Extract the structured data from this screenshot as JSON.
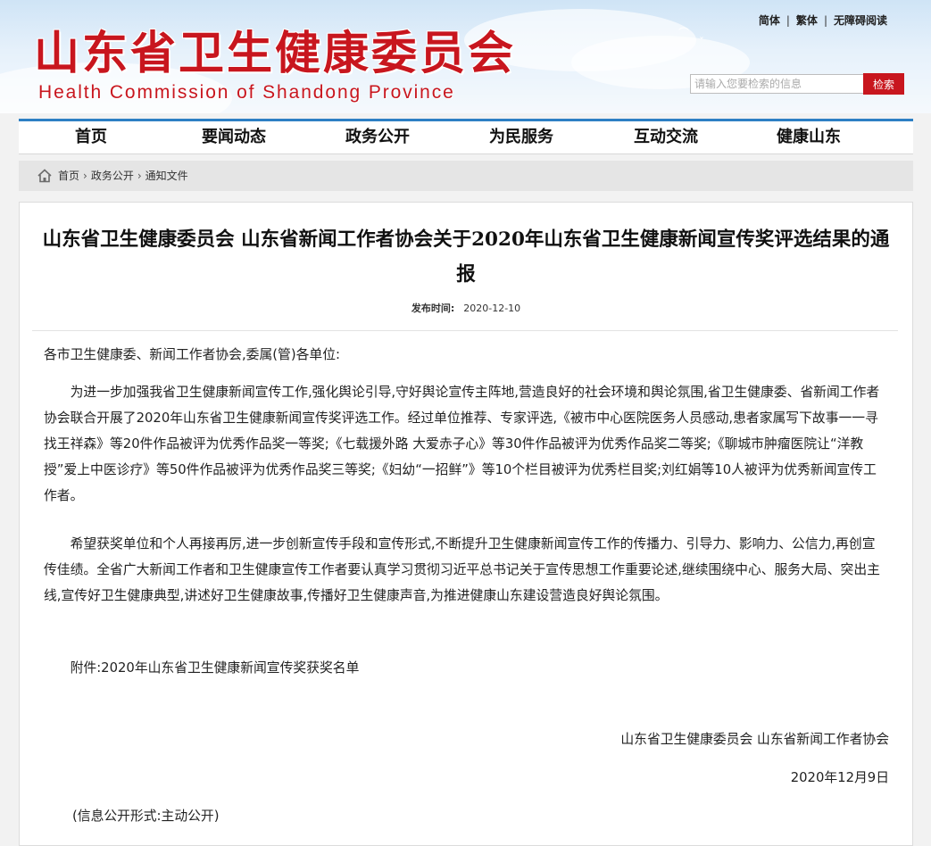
{
  "header": {
    "title": "山东省卫生健康委员会",
    "subtitle": "Health Commission of Shandong Province",
    "links": {
      "simplified": "简体",
      "traditional": "繁体",
      "accessible": "无障碍阅读"
    },
    "separator": "|",
    "search": {
      "placeholder": "请输入您要检索的信息",
      "button": "检索"
    }
  },
  "nav": {
    "items": [
      {
        "label": "首页"
      },
      {
        "label": "要闻动态"
      },
      {
        "label": "政务公开"
      },
      {
        "label": "为民服务"
      },
      {
        "label": "互动交流"
      },
      {
        "label": "健康山东"
      }
    ]
  },
  "breadcrumb": {
    "items": [
      "首页",
      "政务公开",
      "通知文件"
    ],
    "arrow": "›"
  },
  "article": {
    "title": "山东省卫生健康委员会 山东省新闻工作者协会关于2020年山东省卫生健康新闻宣传奖评选结果的通报",
    "date_label": "发布时间:",
    "date": "2020-12-10",
    "greeting": "各市卫生健康委、新闻工作者协会,委属(管)各单位:",
    "paragraphs": [
      "为进一步加强我省卫生健康新闻宣传工作,强化舆论引导,守好舆论宣传主阵地,营造良好的社会环境和舆论氛围,省卫生健康委、省新闻工作者协会联合开展了2020年山东省卫生健康新闻宣传奖评选工作。经过单位推荐、专家评选,《被市中心医院医务人员感动,患者家属写下故事一一寻找王祥森》等20件作品被评为优秀作品奖一等奖;《七载援外路 大爱赤子心》等30件作品被评为优秀作品奖二等奖;《聊城市肿瘤医院让“洋教授”爱上中医诊疗》等50件作品被评为优秀作品奖三等奖;《妇幼“一招鲜”》等10个栏目被评为优秀栏目奖;刘红娟等10人被评为优秀新闻宣传工作者。",
      "希望获奖单位和个人再接再厉,进一步创新宣传手段和宣传形式,不断提升卫生健康新闻宣传工作的传播力、引导力、影响力、公信力,再创宣传佳绩。全省广大新闻工作者和卫生健康宣传工作者要认真学习贯彻习近平总书记关于宣传思想工作重要论述,继续围绕中心、服务大局、突出主线,宣传好卫生健康典型,讲述好卫生健康故事,传播好卫生健康声音,为推进健康山东建设营造良好舆论氛围。"
    ],
    "attachment": "附件:2020年山东省卫生健康新闻宣传奖获奖名单",
    "signature_org": "山东省卫生健康委员会 山东省新闻工作者协会",
    "signature_date": "2020年12月9日",
    "disclosure": "(信息公开形式:主动公开)"
  }
}
